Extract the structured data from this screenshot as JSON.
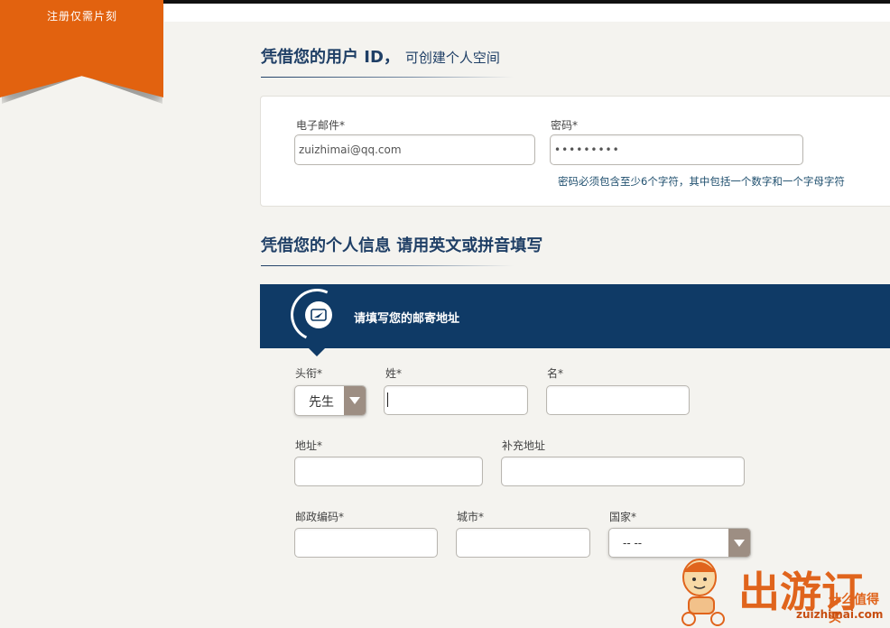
{
  "ribbon": {
    "text": "注册仅需片刻"
  },
  "section1": {
    "title": "凭借您的用户 ID，",
    "subtitle": "可创建个人空间"
  },
  "account": {
    "email_label": "电子邮件*",
    "email_value": "zuizhimai@qq.com",
    "password_label": "密码*",
    "password_value": "•••••••••",
    "password_hint": "密码必须包含至少6个字符，其中包括一个数字和一个字母字符"
  },
  "section2": {
    "title": "凭借您的个人信息 请用英文或拼音填写"
  },
  "address_banner": {
    "text": "请填写您的邮寄地址",
    "icon": "mail-icon"
  },
  "form": {
    "title_label": "头衔*",
    "title_value": "先生",
    "lastname_label": "姓*",
    "firstname_label": "名*",
    "address_label": "地址*",
    "address2_label": "补充地址",
    "zip_label": "邮政编码*",
    "city_label": "城市*",
    "country_label": "国家*",
    "country_value": "-- --"
  },
  "watermark": {
    "logo_text": "出游订",
    "tagline": "什么值得买",
    "url": "zuizhimai.com"
  },
  "colors": {
    "accent": "#e2620f",
    "navy": "#0f3a66",
    "hint": "#1f4f6e"
  }
}
